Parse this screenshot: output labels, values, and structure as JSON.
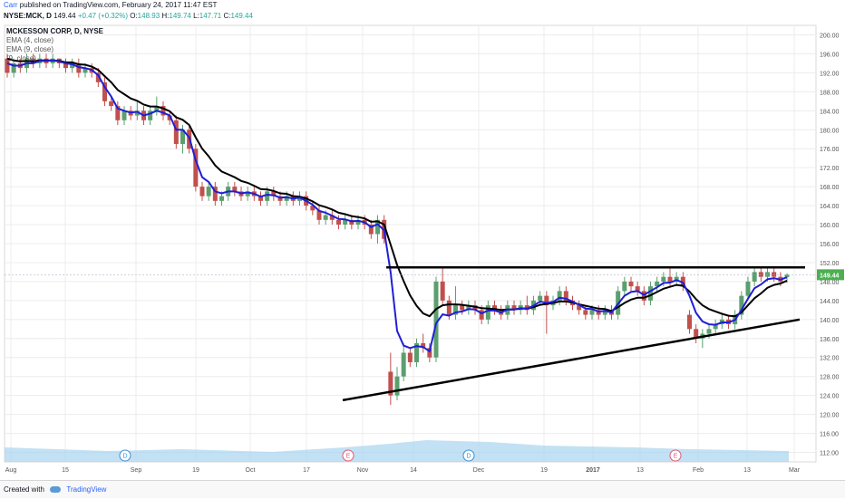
{
  "header": {
    "author": "Carr",
    "published_text": "published on TradingView.com, February 24, 2017 11:47 EST"
  },
  "ohlc_line": {
    "symbol": "NYSE:MCK, D",
    "last": "149.44",
    "change": "+0.47 (+0.32%)",
    "open_label": "O:",
    "open": "148.93",
    "high_label": "H:",
    "high": "149.74",
    "low_label": "L:",
    "low": "147.71",
    "close_label": "C:",
    "close": "149.44"
  },
  "legend": {
    "title": "MCKESSON CORP, D, NYSE",
    "ema4": "EMA (4, close)",
    "ema9": "EMA (9, close)",
    "third": "(9, close)"
  },
  "footer": {
    "created_with": "Created with",
    "brand": "TradingView"
  },
  "colors": {
    "up_candle": "#5b9f6f",
    "down_candle": "#c0504d",
    "ema_fast": "#1f1fd6",
    "ema_slow": "#000000",
    "volume": "#a8d4f0",
    "price_label_bg": "#4caf50",
    "grid": "#ececec"
  },
  "chart_data": {
    "type": "candlestick",
    "title": "MCKESSON CORP, D, NYSE",
    "y_axis": {
      "ticks": [
        "200.00",
        "196.00",
        "192.00",
        "188.00",
        "184.00",
        "180.00",
        "176.00",
        "172.00",
        "168.00",
        "164.00",
        "160.00",
        "156.00",
        "152.00",
        "148.00",
        "144.00",
        "140.00",
        "136.00",
        "132.00",
        "128.00",
        "124.00",
        "120.00",
        "116.00",
        "112.00"
      ],
      "range": [
        110,
        202
      ]
    },
    "x_axis": {
      "ticks": [
        "Aug",
        "15",
        "Sep",
        "19",
        "Oct",
        "17",
        "Nov",
        "14",
        "Dec",
        "19",
        "2017",
        "13",
        "Feb",
        "13",
        "Mar"
      ]
    },
    "current_price_label": "149.44",
    "event_markers": [
      {
        "label": "D",
        "kind": "dividend"
      },
      {
        "label": "E",
        "kind": "earnings"
      },
      {
        "label": "D",
        "kind": "dividend"
      },
      {
        "label": "E",
        "kind": "earnings"
      }
    ],
    "candles": [
      {
        "o": 195,
        "c": 192,
        "h": 196,
        "l": 191
      },
      {
        "o": 192,
        "c": 194,
        "h": 195,
        "l": 191
      },
      {
        "o": 194,
        "c": 193,
        "h": 195,
        "l": 192
      },
      {
        "o": 193,
        "c": 195,
        "h": 196,
        "l": 192
      },
      {
        "o": 195,
        "c": 194,
        "h": 196,
        "l": 193
      },
      {
        "o": 194,
        "c": 195,
        "h": 196,
        "l": 193
      },
      {
        "o": 195,
        "c": 194,
        "h": 196,
        "l": 193
      },
      {
        "o": 194,
        "c": 195,
        "h": 196,
        "l": 193
      },
      {
        "o": 195,
        "c": 194,
        "h": 195,
        "l": 193
      },
      {
        "o": 194,
        "c": 193,
        "h": 195,
        "l": 192
      },
      {
        "o": 193,
        "c": 194,
        "h": 195,
        "l": 192
      },
      {
        "o": 194,
        "c": 192,
        "h": 195,
        "l": 191
      },
      {
        "o": 192,
        "c": 193,
        "h": 194,
        "l": 191
      },
      {
        "o": 193,
        "c": 192,
        "h": 194,
        "l": 191
      },
      {
        "o": 192,
        "c": 190,
        "h": 193,
        "l": 189
      },
      {
        "o": 190,
        "c": 186,
        "h": 191,
        "l": 185
      },
      {
        "o": 186,
        "c": 185,
        "h": 187,
        "l": 184
      },
      {
        "o": 185,
        "c": 182,
        "h": 186,
        "l": 181
      },
      {
        "o": 182,
        "c": 184,
        "h": 185,
        "l": 181
      },
      {
        "o": 184,
        "c": 183,
        "h": 185,
        "l": 182
      },
      {
        "o": 183,
        "c": 184,
        "h": 186,
        "l": 182
      },
      {
        "o": 184,
        "c": 182,
        "h": 185,
        "l": 181
      },
      {
        "o": 182,
        "c": 184,
        "h": 185,
        "l": 181
      },
      {
        "o": 184,
        "c": 185,
        "h": 187,
        "l": 183
      },
      {
        "o": 185,
        "c": 183,
        "h": 186,
        "l": 182
      },
      {
        "o": 183,
        "c": 182,
        "h": 184,
        "l": 181
      },
      {
        "o": 182,
        "c": 177,
        "h": 183,
        "l": 176
      },
      {
        "o": 177,
        "c": 180,
        "h": 181,
        "l": 175
      },
      {
        "o": 180,
        "c": 176,
        "h": 181,
        "l": 175
      },
      {
        "o": 176,
        "c": 168,
        "h": 177,
        "l": 167
      },
      {
        "o": 168,
        "c": 166,
        "h": 169,
        "l": 165
      },
      {
        "o": 166,
        "c": 168,
        "h": 169,
        "l": 165
      },
      {
        "o": 168,
        "c": 165,
        "h": 169,
        "l": 164
      },
      {
        "o": 165,
        "c": 166,
        "h": 167,
        "l": 164
      },
      {
        "o": 166,
        "c": 168,
        "h": 169,
        "l": 165
      },
      {
        "o": 168,
        "c": 167,
        "h": 169,
        "l": 166
      },
      {
        "o": 167,
        "c": 166,
        "h": 168,
        "l": 165
      },
      {
        "o": 166,
        "c": 167,
        "h": 168,
        "l": 165
      },
      {
        "o": 167,
        "c": 166,
        "h": 168,
        "l": 165
      },
      {
        "o": 166,
        "c": 165,
        "h": 167,
        "l": 164
      },
      {
        "o": 165,
        "c": 167,
        "h": 168,
        "l": 164
      },
      {
        "o": 167,
        "c": 166,
        "h": 168,
        "l": 165
      },
      {
        "o": 166,
        "c": 165,
        "h": 167,
        "l": 164
      },
      {
        "o": 165,
        "c": 166,
        "h": 167,
        "l": 164
      },
      {
        "o": 166,
        "c": 165,
        "h": 167,
        "l": 164
      },
      {
        "o": 165,
        "c": 166,
        "h": 167,
        "l": 164
      },
      {
        "o": 166,
        "c": 164,
        "h": 167,
        "l": 163
      },
      {
        "o": 164,
        "c": 163,
        "h": 165,
        "l": 162
      },
      {
        "o": 163,
        "c": 161,
        "h": 164,
        "l": 160
      },
      {
        "o": 161,
        "c": 162,
        "h": 163,
        "l": 160
      },
      {
        "o": 162,
        "c": 161,
        "h": 163,
        "l": 160
      },
      {
        "o": 161,
        "c": 160,
        "h": 162,
        "l": 159
      },
      {
        "o": 160,
        "c": 161,
        "h": 162,
        "l": 159
      },
      {
        "o": 161,
        "c": 160,
        "h": 162,
        "l": 159
      },
      {
        "o": 160,
        "c": 161,
        "h": 162,
        "l": 159
      },
      {
        "o": 161,
        "c": 160,
        "h": 162,
        "l": 159
      },
      {
        "o": 160,
        "c": 158,
        "h": 161,
        "l": 157
      },
      {
        "o": 158,
        "c": 161,
        "h": 162,
        "l": 156
      },
      {
        "o": 161,
        "c": 157,
        "h": 162,
        "l": 156
      },
      {
        "o": 129,
        "c": 124,
        "h": 133,
        "l": 122
      },
      {
        "o": 124,
        "c": 128,
        "h": 130,
        "l": 123
      },
      {
        "o": 128,
        "c": 133,
        "h": 135,
        "l": 127
      },
      {
        "o": 133,
        "c": 131,
        "h": 134,
        "l": 130
      },
      {
        "o": 131,
        "c": 135,
        "h": 136,
        "l": 130
      },
      {
        "o": 135,
        "c": 134,
        "h": 137,
        "l": 133
      },
      {
        "o": 134,
        "c": 132,
        "h": 135,
        "l": 131
      },
      {
        "o": 132,
        "c": 148,
        "h": 149,
        "l": 131
      },
      {
        "o": 148,
        "c": 144,
        "h": 151,
        "l": 143
      },
      {
        "o": 144,
        "c": 141,
        "h": 145,
        "l": 140
      },
      {
        "o": 141,
        "c": 143,
        "h": 147,
        "l": 140
      },
      {
        "o": 143,
        "c": 142,
        "h": 144,
        "l": 141
      },
      {
        "o": 142,
        "c": 143,
        "h": 144,
        "l": 141
      },
      {
        "o": 143,
        "c": 142,
        "h": 144,
        "l": 141
      },
      {
        "o": 142,
        "c": 140,
        "h": 143,
        "l": 139
      },
      {
        "o": 140,
        "c": 143,
        "h": 144,
        "l": 139
      },
      {
        "o": 143,
        "c": 142,
        "h": 144,
        "l": 141
      },
      {
        "o": 142,
        "c": 141,
        "h": 143,
        "l": 140
      },
      {
        "o": 141,
        "c": 143,
        "h": 144,
        "l": 140
      },
      {
        "o": 143,
        "c": 142,
        "h": 144,
        "l": 141
      },
      {
        "o": 142,
        "c": 143,
        "h": 144,
        "l": 141
      },
      {
        "o": 143,
        "c": 142,
        "h": 145,
        "l": 141
      },
      {
        "o": 142,
        "c": 144,
        "h": 145,
        "l": 141
      },
      {
        "o": 144,
        "c": 145,
        "h": 146,
        "l": 143
      },
      {
        "o": 145,
        "c": 143,
        "h": 146,
        "l": 137
      },
      {
        "o": 143,
        "c": 144,
        "h": 145,
        "l": 142
      },
      {
        "o": 144,
        "c": 146,
        "h": 147,
        "l": 143
      },
      {
        "o": 146,
        "c": 144,
        "h": 147,
        "l": 143
      },
      {
        "o": 144,
        "c": 143,
        "h": 145,
        "l": 142
      },
      {
        "o": 143,
        "c": 142,
        "h": 144,
        "l": 141
      },
      {
        "o": 142,
        "c": 141,
        "h": 143,
        "l": 140
      },
      {
        "o": 141,
        "c": 142,
        "h": 143,
        "l": 140
      },
      {
        "o": 142,
        "c": 141,
        "h": 143,
        "l": 140
      },
      {
        "o": 141,
        "c": 142,
        "h": 143,
        "l": 140
      },
      {
        "o": 142,
        "c": 141,
        "h": 143,
        "l": 140
      },
      {
        "o": 141,
        "c": 146,
        "h": 147,
        "l": 140
      },
      {
        "o": 146,
        "c": 148,
        "h": 149,
        "l": 145
      },
      {
        "o": 148,
        "c": 147,
        "h": 149,
        "l": 146
      },
      {
        "o": 147,
        "c": 146,
        "h": 148,
        "l": 145
      },
      {
        "o": 146,
        "c": 144,
        "h": 147,
        "l": 143
      },
      {
        "o": 144,
        "c": 147,
        "h": 148,
        "l": 143
      },
      {
        "o": 147,
        "c": 148,
        "h": 149,
        "l": 146
      },
      {
        "o": 148,
        "c": 149,
        "h": 150,
        "l": 147
      },
      {
        "o": 149,
        "c": 148,
        "h": 151,
        "l": 147
      },
      {
        "o": 148,
        "c": 149,
        "h": 150,
        "l": 147
      },
      {
        "o": 149,
        "c": 147,
        "h": 150,
        "l": 146
      },
      {
        "o": 141,
        "c": 138,
        "h": 142,
        "l": 137
      },
      {
        "o": 138,
        "c": 136,
        "h": 139,
        "l": 135
      },
      {
        "o": 136,
        "c": 137,
        "h": 138,
        "l": 134
      },
      {
        "o": 137,
        "c": 138,
        "h": 139,
        "l": 136
      },
      {
        "o": 138,
        "c": 139,
        "h": 140,
        "l": 137
      },
      {
        "o": 139,
        "c": 140,
        "h": 141,
        "l": 138
      },
      {
        "o": 140,
        "c": 139,
        "h": 141,
        "l": 138
      },
      {
        "o": 139,
        "c": 141,
        "h": 142,
        "l": 138
      },
      {
        "o": 141,
        "c": 145,
        "h": 146,
        "l": 140
      },
      {
        "o": 145,
        "c": 148,
        "h": 149,
        "l": 144
      },
      {
        "o": 148,
        "c": 150,
        "h": 151,
        "l": 147
      },
      {
        "o": 150,
        "c": 149,
        "h": 151,
        "l": 148
      },
      {
        "o": 149,
        "c": 150,
        "h": 151,
        "l": 148
      },
      {
        "o": 150,
        "c": 149,
        "h": 151,
        "l": 148
      },
      {
        "o": 149,
        "c": 148,
        "h": 150,
        "l": 147
      },
      {
        "o": 148.93,
        "c": 149.44,
        "h": 149.74,
        "l": 147.71
      }
    ],
    "ema_fast": [
      194,
      193.5,
      193.5,
      194,
      194,
      194.5,
      194.5,
      194.6,
      194.4,
      194,
      193.8,
      193.2,
      193,
      192.6,
      191.5,
      189,
      187,
      184.5,
      184,
      183.6,
      183.8,
      183,
      183.4,
      184,
      183.6,
      183,
      180,
      180,
      178.4,
      173.6,
      170,
      169,
      167,
      166.6,
      167,
      167,
      166.6,
      166.8,
      166.5,
      165.9,
      166.3,
      166.2,
      165.7,
      165.8,
      165.5,
      165.7,
      165,
      164.2,
      162.9,
      162.5,
      161.9,
      161.2,
      161.1,
      160.7,
      160.8,
      160.5,
      159.5,
      160.1,
      158.8,
      150,
      137.6,
      134.5,
      134,
      134.4,
      134.2,
      133.3,
      139.2,
      141.1,
      140.8,
      141.5,
      141.7,
      142.2,
      142.1,
      141.3,
      141.9,
      141.9,
      141.5,
      142.1,
      142.1,
      142.4,
      142.3,
      142.9,
      143.8,
      143.5,
      143.7,
      144.6,
      144.4,
      143.8,
      143.1,
      142.3,
      142.2,
      141.7,
      141.8,
      141.5,
      143.3,
      145,
      145.8,
      146,
      145.2,
      146,
      146.8,
      147.7,
      147.8,
      148.3,
      147.8,
      145,
      141.4,
      139.6,
      139,
      138.9,
      139.4,
      139.4,
      139.9,
      142,
      144.4,
      146.6,
      147.4,
      148.5,
      148.7,
      148.4,
      148.9
    ],
    "ema_slow": [
      195,
      194.6,
      194.4,
      194.5,
      194.4,
      194.6,
      194.6,
      194.6,
      194.5,
      194.2,
      194.2,
      193.8,
      193.7,
      193.3,
      192.6,
      191.3,
      190,
      188.4,
      187.5,
      186.6,
      186.1,
      185.3,
      184.9,
      184.9,
      184.5,
      183.9,
      182.6,
      182.1,
      181,
      178.4,
      176,
      174.4,
      172.5,
      171.2,
      170.6,
      170,
      169.2,
      168.8,
      168.2,
      167.5,
      167.4,
      167.1,
      166.6,
      166.5,
      166,
      165.9,
      165.5,
      164.9,
      164.1,
      163.7,
      163.2,
      162.5,
      162.2,
      161.8,
      161.6,
      161.3,
      160.6,
      160.7,
      160,
      155.8,
      151.5,
      148.1,
      145.1,
      142.9,
      141.3,
      140.7,
      142.2,
      143,
      143.2,
      143.2,
      143.1,
      142.9,
      142.7,
      142.4,
      142.3,
      142.2,
      142,
      142.1,
      142.1,
      142.3,
      142.3,
      142.6,
      143.1,
      143.3,
      143.5,
      143.8,
      143.8,
      143.6,
      143.2,
      142.9,
      142.6,
      142.3,
      142.2,
      141.8,
      142.6,
      143.5,
      144.2,
      144.6,
      144.6,
      145.1,
      145.8,
      146.5,
      146.9,
      147.3,
      147.1,
      145.9,
      144.3,
      143,
      142.2,
      141.7,
      141.2,
      140.8,
      140.7,
      141.5,
      143,
      144.5,
      145.5,
      146.7,
      147.3,
      147.6,
      148.2
    ]
  }
}
